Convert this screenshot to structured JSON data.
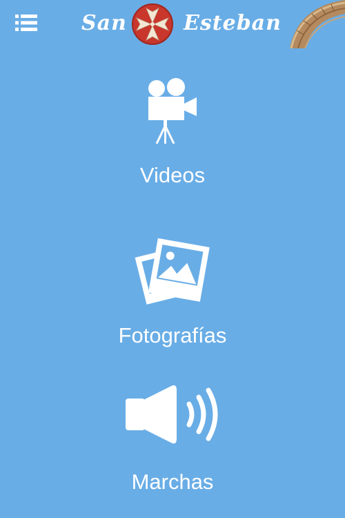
{
  "header": {
    "menu_icon": "hamburger-list-icon",
    "brand_left": "San",
    "brand_right": "Esteban",
    "logo_icon": "maltese-cross-emblem",
    "corner_image": "stone-arch-image"
  },
  "menu": {
    "items": [
      {
        "label": "Videos",
        "icon": "movie-camera-icon"
      },
      {
        "label": "Fotografías",
        "icon": "photos-icon"
      },
      {
        "label": "Marchas",
        "icon": "speaker-volume-icon"
      }
    ]
  },
  "colors": {
    "background": "#69ade6",
    "foreground": "#ffffff",
    "logo_red": "#c8362c",
    "logo_cross": "#f3e7d4"
  }
}
